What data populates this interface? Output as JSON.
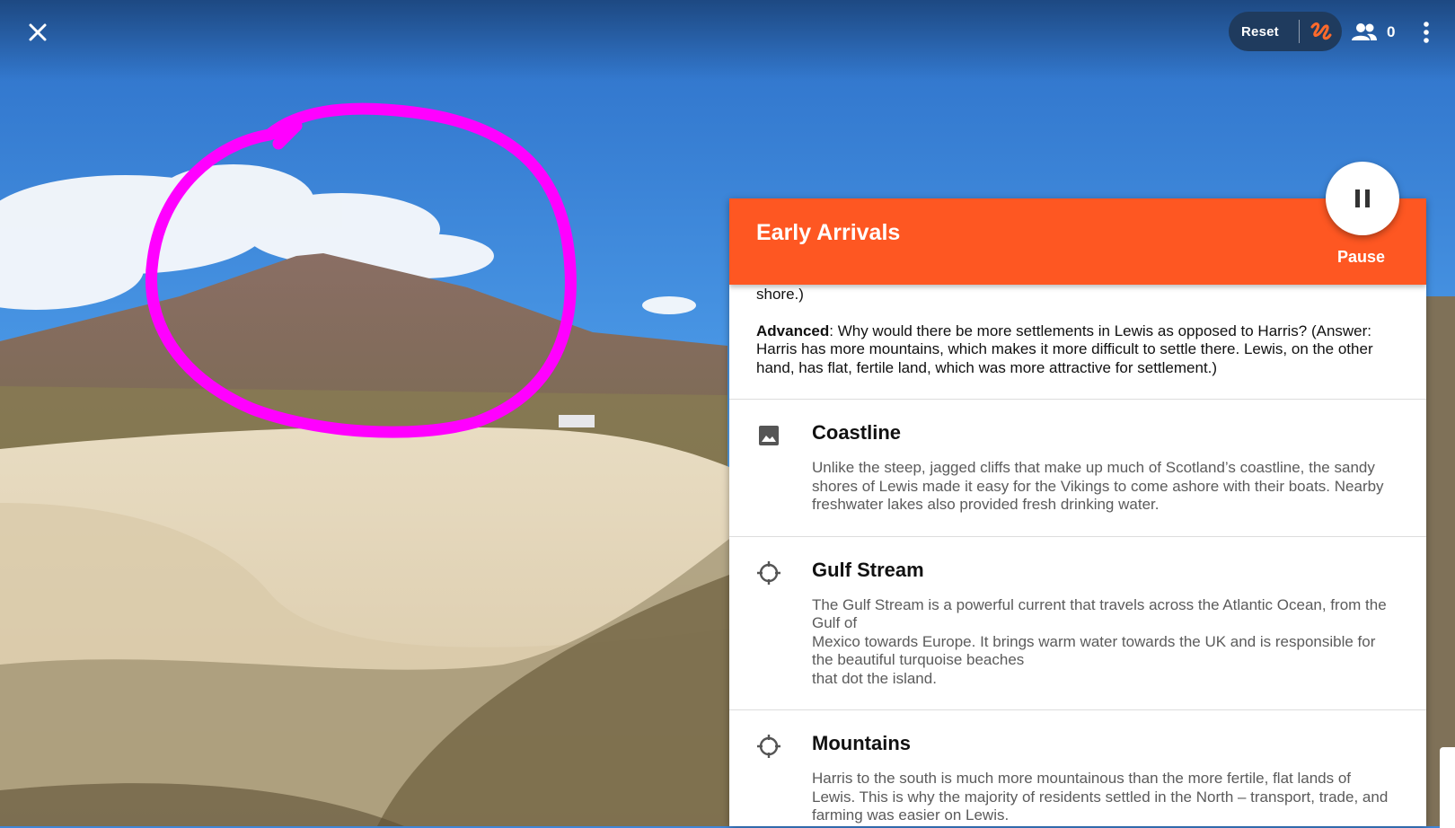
{
  "window": {
    "close_icon": "close-icon",
    "reset_label": "Reset",
    "annotate_icon": "scribble-icon",
    "participants_icon": "people-icon",
    "participants_count": "0",
    "menu_icon": "more-vert-icon"
  },
  "panel": {
    "title": "Early Arrivals",
    "pause_label": "Pause",
    "pause_icon": "pause-icon",
    "header_color": "#fe5722",
    "intro": {
      "line_shore": "shore.)",
      "advanced_label": "Advanced",
      "advanced_text": ": Why would there be more settlements in Lewis as opposed to Harris? (Answer: Harris has more mountains, which makes it more difficult to settle there. Lewis, on the other hand, has flat, fertile land, which was more attractive for settlement.)"
    },
    "items": [
      {
        "icon": "image-icon",
        "title": "Coastline",
        "lines": [
          "Unlike the steep, jagged cliffs that make up much of Scotland’s coastline, the sandy shores of Lewis made it easy for the Vikings to come ashore with their boats. Nearby freshwater lakes also provided fresh drinking water."
        ]
      },
      {
        "icon": "crosshair-icon",
        "title": "Gulf Stream",
        "lines": [
          "The Gulf Stream is a powerful current that travels across the Atlantic Ocean, from the Gulf of",
          "Mexico towards Europe. It brings warm water towards the UK and is responsible for the beautiful turquoise beaches",
          "that dot the island."
        ]
      },
      {
        "icon": "crosshair-icon",
        "title": "Mountains",
        "lines": [
          "Harris to the south is much more mountainous than the more fertile, flat lands of Lewis. This is why the majority of residents settled in the North – transport, trade, and farming was easier on Lewis."
        ]
      }
    ]
  },
  "annotation": {
    "color": "#ff00ff"
  }
}
